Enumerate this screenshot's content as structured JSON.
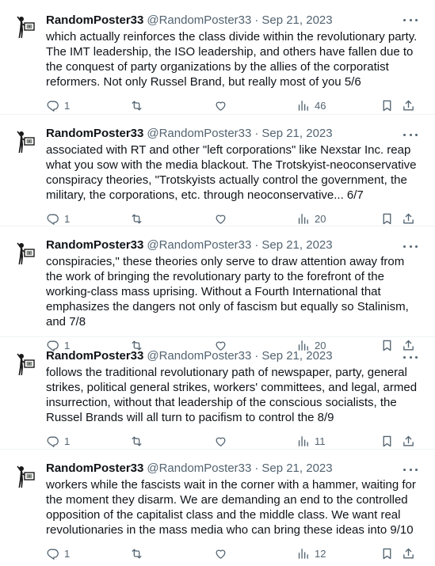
{
  "tweets": [
    {
      "name": "RandomPoster33",
      "handle": "@RandomPoster33",
      "sep": "·",
      "date": "Sep 21, 2023",
      "text": "which actually reinforces the class divide within the revolutionary party. The IMT leadership, the ISO leadership, and others have fallen due to the conquest of party organizations by the allies of the corporatist reformers. Not only Russel Brand, but really most of you 5/6",
      "replies": "1",
      "retweets": "",
      "likes": "",
      "views": "46"
    },
    {
      "name": "RandomPoster33",
      "handle": "@RandomPoster33",
      "sep": "·",
      "date": "Sep 21, 2023",
      "text": "associated with RT and other \"left corporations\" like Nexstar Inc. reap what you sow with the media blackout. The Trotskyist-neoconservative conspiracy theories, \"Trotskyists actually control the government, the military, the corporations, etc. through neoconservative... 6/7",
      "replies": "1",
      "retweets": "",
      "likes": "",
      "views": "20"
    },
    {
      "name": "RandomPoster33",
      "handle": "@RandomPoster33",
      "sep": "·",
      "date": "Sep 21, 2023",
      "text": "conspiracies,\" these theories only serve to draw attention away from the work of bringing the revolutionary party to the forefront of the working-class mass uprising. Without a Fourth International that emphasizes the dangers not only of fascism but equally so Stalinism, and 7/8",
      "replies": "1",
      "retweets": "",
      "likes": "",
      "views": "20"
    },
    {
      "name": "RandomPoster33",
      "handle": "@RandomPoster33",
      "sep": "·",
      "date": "Sep 21, 2023",
      "text": "follows the traditional revolutionary path of newspaper, party, general strikes, political general strikes, workers' committees, and legal, armed insurrection, without that leadership of the conscious socialists, the Russel Brands will all turn to pacifism to control the 8/9",
      "replies": "1",
      "retweets": "",
      "likes": "",
      "views": "11"
    },
    {
      "name": "RandomPoster33",
      "handle": "@RandomPoster33",
      "sep": "·",
      "date": "Sep 21, 2023",
      "text": "workers while the fascists wait in the corner with a hammer, waiting for the moment they disarm. We are demanding an end to the controlled opposition of the capitalist class and the middle class. We want real revolutionaries in the mass media who can bring these ideas into 9/10",
      "replies": "1",
      "retweets": "",
      "likes": "",
      "views": "12"
    }
  ],
  "colors": {
    "text": "#0f1419",
    "secondary": "#536471",
    "divider": "#eff3f4",
    "avatar_bg": "#ffffff"
  },
  "icons": {
    "avatar": "figure-holding-sign-avatar",
    "more": "more-dots-icon",
    "reply": "reply-icon",
    "retweet": "retweet-icon",
    "like": "heart-icon",
    "views": "views-icon",
    "bookmark": "bookmark-icon",
    "share": "share-icon"
  }
}
